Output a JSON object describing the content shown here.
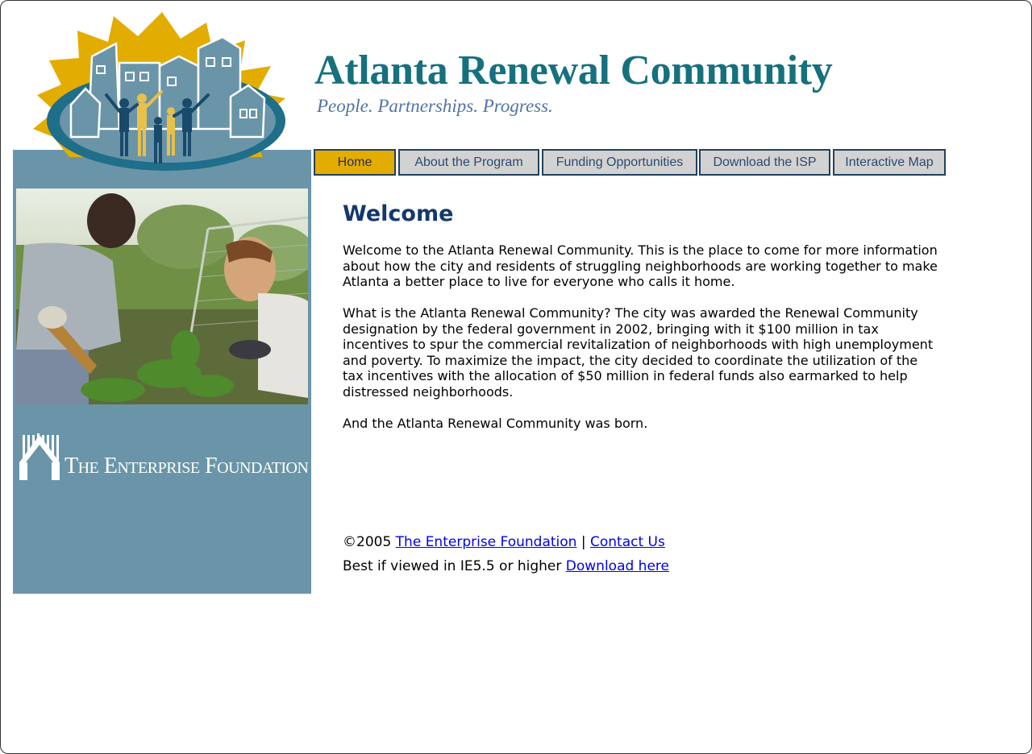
{
  "header": {
    "title": "Atlanta Renewal Community",
    "tagline": "People. Partnerships. Progress."
  },
  "nav": [
    {
      "label": "Home",
      "active": true
    },
    {
      "label": "About the Program",
      "active": false
    },
    {
      "label": "Funding Opportunities",
      "active": false
    },
    {
      "label": "Download the ISP",
      "active": false
    },
    {
      "label": "Interactive Map",
      "active": false
    }
  ],
  "sidebar": {
    "partner_logo_text": "The Enterprise Foundation"
  },
  "main": {
    "heading": "Welcome",
    "paragraphs": [
      "Welcome to the Atlanta Renewal Community. This is the place to come for more information about how the city and residents of struggling neighborhoods are working together to make Atlanta a better place to live for everyone who calls it home.",
      "What is the Atlanta Renewal Community? The city was awarded the Renewal Community designation by the federal government in 2002, bringing with it $100 million in tax incentives to spur the commercial revitalization of neighborhoods with high unemployment and poverty. To maximize the impact, the city decided to coordinate the utilization of the tax incentives with the allocation of $50 million in federal funds also earmarked to help distressed neighborhoods.",
      "And the Atlanta Renewal Community was born."
    ]
  },
  "footer": {
    "copyright": "©2005",
    "enterprise_link": "The Enterprise Foundation",
    "separator": "|",
    "contact_link": "Contact Us",
    "browser_note": "Best if viewed in IE5.5 or higher",
    "download_link": "Download here"
  },
  "colors": {
    "sidebar": "#6a95a8",
    "nav_active": "#e3ac00",
    "nav_inactive": "#d2d2d2",
    "title": "#16707e",
    "heading": "#13386b",
    "link": "#0000ee"
  }
}
